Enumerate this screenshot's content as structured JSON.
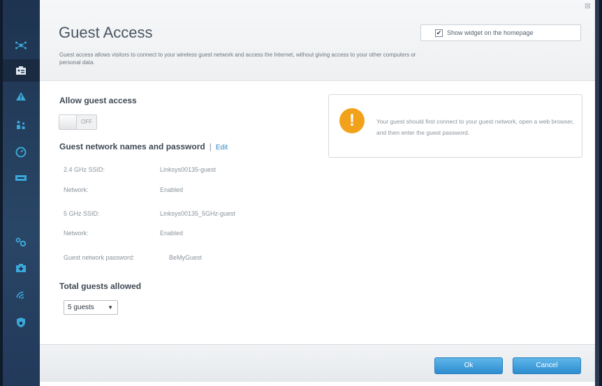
{
  "page": {
    "title": "Guest Access",
    "intro": "Guest access allows visitors to connect to your wireless guest network and access the Internet, without giving access to your other computers or personal data.",
    "close_glyph": "⊠"
  },
  "widget": {
    "checked": true,
    "label": "Show widget on the homepage"
  },
  "allow_guest": {
    "heading": "Allow guest access",
    "toggle_state": "OFF"
  },
  "networks": {
    "heading": "Guest network names and password",
    "separator": "|",
    "edit_label": "Edit",
    "rows": [
      {
        "label": "2.4 GHz SSID:",
        "value": "Linksys00135-guest"
      },
      {
        "label": "Network:",
        "value": "Enabled"
      },
      {
        "label": "5 GHz SSID:",
        "value": "Linksys00135_5GHz-guest"
      },
      {
        "label": "Network:",
        "value": "Enabled"
      },
      {
        "label": "Guest network password:",
        "value": "BeMyGuest"
      }
    ]
  },
  "info": {
    "icon": "!",
    "text": "Your guest should first connect to your guest network, open a web browser, and then enter the guest password."
  },
  "total": {
    "heading": "Total guests allowed",
    "selected": "5 guests",
    "arrow": "▼"
  },
  "footer": {
    "ok_label": "Ok",
    "cancel_label": "Cancel"
  },
  "sidebar": {
    "icons": [
      "network-map-icon",
      "guest-access-icon",
      "warning-icon",
      "parental-controls-icon",
      "speed-test-icon",
      "external-storage-icon",
      "connectivity-icon",
      "troubleshooting-icon",
      "wireless-icon",
      "security-icon"
    ],
    "active": "guest-access-icon"
  },
  "colors": {
    "accent": "#2d8ccf",
    "warning": "#f2a11b",
    "sidebar_icon": "#3aa8d8"
  }
}
